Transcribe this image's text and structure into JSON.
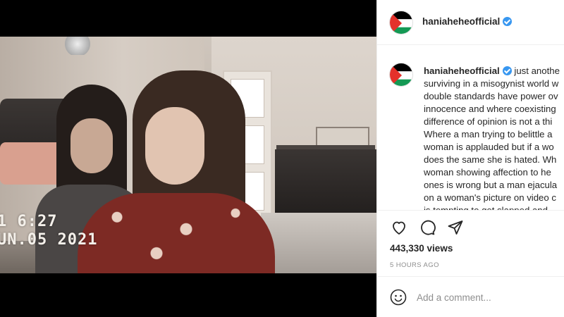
{
  "video": {
    "timestamp_time": "1  6:27",
    "timestamp_date": "UN.05 2021",
    "mute_icon": "speaker-muted-icon"
  },
  "post": {
    "avatar_icon": "palestine-flag-avatar",
    "header_username": "haniaheheofficial",
    "caption_username": "haniaheheofficial",
    "caption_lines": [
      "just anothe",
      "surviving in a misogynist world w",
      "double standards have power ov",
      "innocence and where coexisting",
      "difference of opinion is not a thi",
      "Where a man trying to belittle a",
      "woman is applauded but if a wo",
      "does the same she is hated. Wh",
      "woman showing affection to he",
      "ones is wrong but a man ejacula",
      "on a woman's picture on video c",
      "is tempting to get slapped and"
    ],
    "views": "443,330 views",
    "time_ago": "5 HOURS AGO",
    "comment_placeholder": "Add a comment..."
  },
  "colors": {
    "verified": "#3897f0",
    "text": "#262626",
    "muted_text": "#8e8e8e",
    "flag_red": "#e4312b",
    "flag_green": "#149954",
    "flag_black": "#000000"
  }
}
